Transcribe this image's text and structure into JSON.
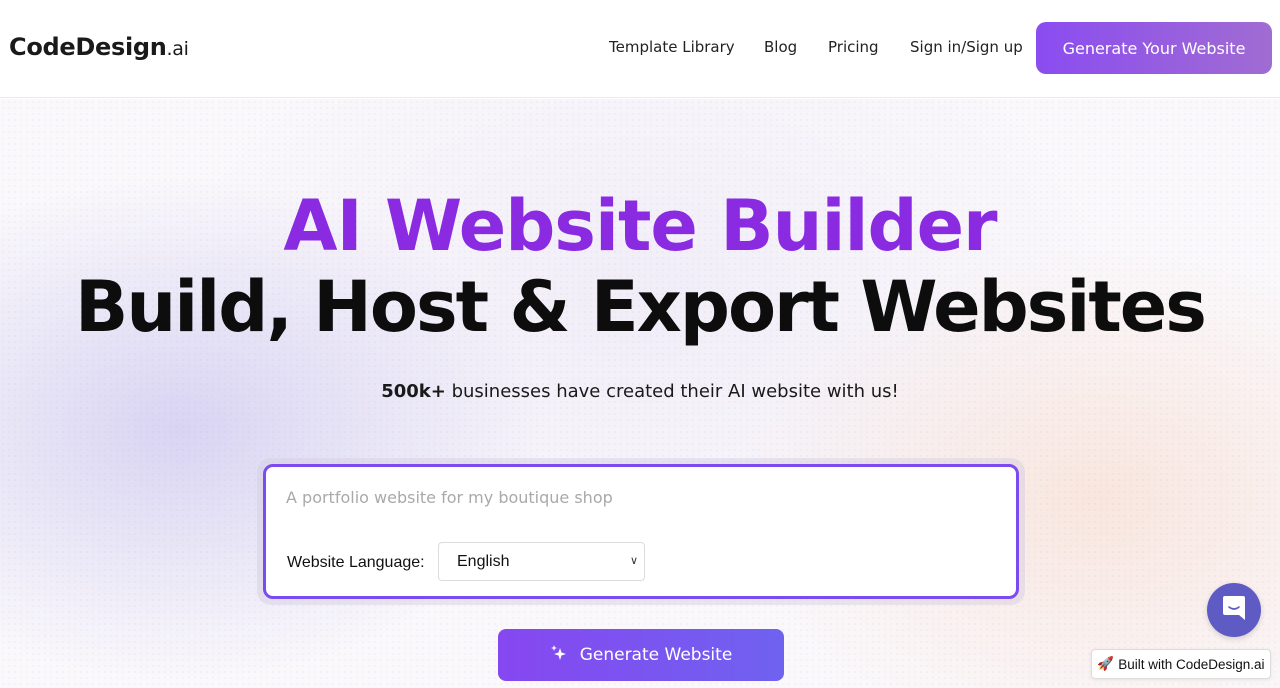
{
  "header": {
    "logo_main": "CodeDesign",
    "logo_suffix": ".ai",
    "nav": {
      "template_library": "Template Library",
      "blog": "Blog",
      "pricing": "Pricing",
      "sign_in": "Sign in/Sign up"
    },
    "cta_label": "Generate Your Website"
  },
  "hero": {
    "title_line1": "AI Website Builder",
    "title_line2": "Build, Host & Export Websites",
    "stat_bold": "500k+",
    "stat_rest": " businesses have created their AI website with us!"
  },
  "prompt": {
    "placeholder": "A portfolio website for my boutique shop",
    "language_label": "Website Language:",
    "language_selected": "English"
  },
  "generate_button": {
    "label": "Generate Website",
    "icon": "sparkle-icon"
  },
  "chat": {
    "icon": "chat-icon"
  },
  "built_with": {
    "emoji": "🚀",
    "label": "Built with CodeDesign.ai"
  },
  "colors": {
    "brand_purple": "#8a2be2",
    "cta_gradient_start": "#8b4cf0",
    "cta_gradient_end": "#a06cd2",
    "generate_gradient_start": "#8647f0",
    "generate_gradient_end": "#6f62f0",
    "chat_bubble": "#5f5bc4"
  }
}
